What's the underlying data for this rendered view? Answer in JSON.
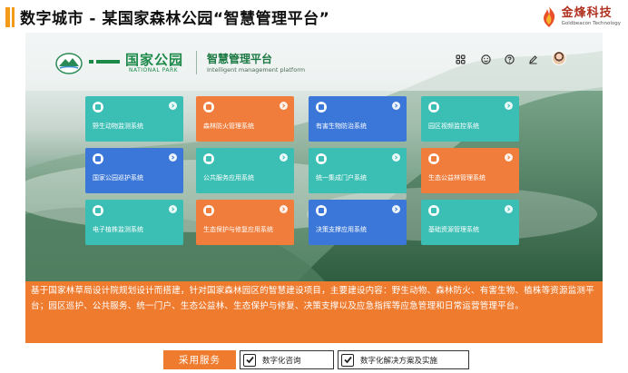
{
  "header": {
    "title": "数字城市 - 某国家森林公园“智慧管理平台”",
    "brand_name": "金烽科技",
    "brand_en": "Goldbeacon Technology"
  },
  "app": {
    "park_logo_text": "国家公园",
    "park_logo_en": "NATIONAL PARK",
    "platform_title": "智慧管理平台",
    "platform_subtitle": "Intelligent management platform",
    "toolbar_icons": [
      "grid-icon",
      "smile-icon",
      "help-icon",
      "edit-icon",
      "avatar"
    ]
  },
  "tiles": [
    {
      "label": "野生动物监测系统",
      "color": "#3bbfb4",
      "icon": "paw-icon"
    },
    {
      "label": "森林防火管理系统",
      "color": "#f07d3b",
      "icon": "shield-icon"
    },
    {
      "label": "有害生物防治系统",
      "color": "#3b77d8",
      "icon": "bug-icon"
    },
    {
      "label": "园区视频监控系统",
      "color": "#3bbfb4",
      "icon": "monitor-icon"
    },
    {
      "label": "国家公园巡护系统",
      "color": "#3b77d8",
      "icon": "location-icon"
    },
    {
      "label": "公共服务应用系统",
      "color": "#3bbfb4",
      "icon": "service-icon"
    },
    {
      "label": "统一集成门户系统",
      "color": "#3bbfb4",
      "icon": "portal-icon"
    },
    {
      "label": "生态公益林管理系统",
      "color": "#f07d3b",
      "icon": "tree-icon"
    },
    {
      "label": "电子植株监测系统",
      "color": "#3bbfb4",
      "icon": "plant-icon"
    },
    {
      "label": "生态保护与修复应用系统",
      "color": "#f07d3b",
      "icon": "leaf-icon"
    },
    {
      "label": "决策支撑应用系统",
      "color": "#3b77d8",
      "icon": "chart-icon"
    },
    {
      "label": "基础资源管理系统",
      "color": "#3bbfb4",
      "icon": "database-icon"
    }
  ],
  "description": "基于国家林草局设计院规划设计而搭建，针对国家森林园区的智慧建设项目，主要建设内容：野生动物、森林防火、有害生物、植株等资源监测平台；园区巡护、公共服务、统一门户、生态公益林、生态保护与修复、决策支撑以及应急指挥等应急管理和日常运营管理平台。",
  "services": {
    "label": "采用服务",
    "items": [
      {
        "text": "数字化咨询",
        "checked": true
      },
      {
        "text": "数字化解决方案及实施",
        "checked": true
      }
    ]
  }
}
